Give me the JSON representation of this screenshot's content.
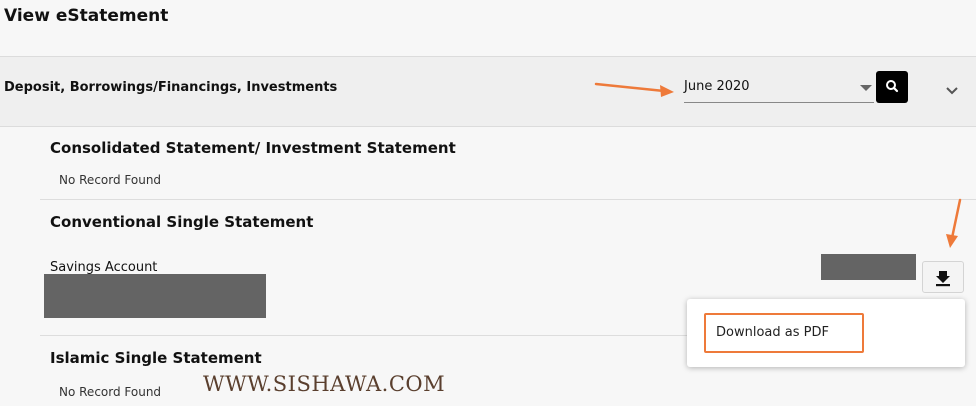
{
  "page": {
    "title": "View eStatement"
  },
  "filter": {
    "category": "Deposit, Borrowings/Financings, Investments",
    "month": "June 2020"
  },
  "sections": [
    {
      "title": "Consolidated Statement/ Investment Statement",
      "status": "No Record Found"
    },
    {
      "title": "Conventional Single Statement",
      "account_type": "Savings Account"
    },
    {
      "title": "Islamic Single Statement",
      "status": "No Record Found"
    }
  ],
  "download_menu": {
    "item": "Download as PDF"
  },
  "watermark": "WWW.SISHAWA.COM",
  "colors": {
    "annotation": "#ee7a3a",
    "redaction": "#646464",
    "search_button": "#000000"
  },
  "icons": {
    "search": "search-icon",
    "collapse": "chevron-down-icon",
    "download": "download-icon"
  }
}
